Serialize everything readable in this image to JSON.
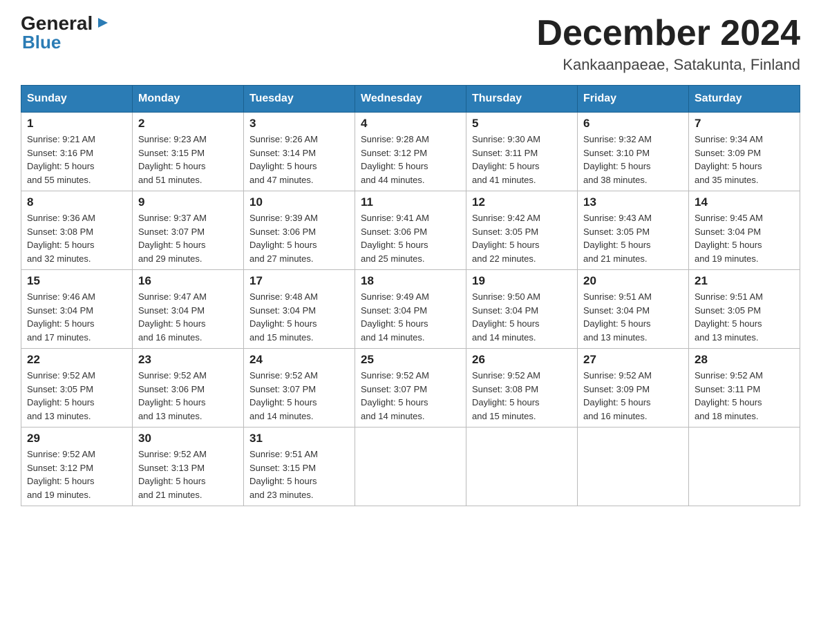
{
  "header": {
    "logo_general": "General",
    "logo_blue": "Blue",
    "month_title": "December 2024",
    "location": "Kankaanpaeae, Satakunta, Finland"
  },
  "days_of_week": [
    "Sunday",
    "Monday",
    "Tuesday",
    "Wednesday",
    "Thursday",
    "Friday",
    "Saturday"
  ],
  "weeks": [
    [
      {
        "day": "1",
        "sunrise": "9:21 AM",
        "sunset": "3:16 PM",
        "daylight": "5 hours and 55 minutes."
      },
      {
        "day": "2",
        "sunrise": "9:23 AM",
        "sunset": "3:15 PM",
        "daylight": "5 hours and 51 minutes."
      },
      {
        "day": "3",
        "sunrise": "9:26 AM",
        "sunset": "3:14 PM",
        "daylight": "5 hours and 47 minutes."
      },
      {
        "day": "4",
        "sunrise": "9:28 AM",
        "sunset": "3:12 PM",
        "daylight": "5 hours and 44 minutes."
      },
      {
        "day": "5",
        "sunrise": "9:30 AM",
        "sunset": "3:11 PM",
        "daylight": "5 hours and 41 minutes."
      },
      {
        "day": "6",
        "sunrise": "9:32 AM",
        "sunset": "3:10 PM",
        "daylight": "5 hours and 38 minutes."
      },
      {
        "day": "7",
        "sunrise": "9:34 AM",
        "sunset": "3:09 PM",
        "daylight": "5 hours and 35 minutes."
      }
    ],
    [
      {
        "day": "8",
        "sunrise": "9:36 AM",
        "sunset": "3:08 PM",
        "daylight": "5 hours and 32 minutes."
      },
      {
        "day": "9",
        "sunrise": "9:37 AM",
        "sunset": "3:07 PM",
        "daylight": "5 hours and 29 minutes."
      },
      {
        "day": "10",
        "sunrise": "9:39 AM",
        "sunset": "3:06 PM",
        "daylight": "5 hours and 27 minutes."
      },
      {
        "day": "11",
        "sunrise": "9:41 AM",
        "sunset": "3:06 PM",
        "daylight": "5 hours and 25 minutes."
      },
      {
        "day": "12",
        "sunrise": "9:42 AM",
        "sunset": "3:05 PM",
        "daylight": "5 hours and 22 minutes."
      },
      {
        "day": "13",
        "sunrise": "9:43 AM",
        "sunset": "3:05 PM",
        "daylight": "5 hours and 21 minutes."
      },
      {
        "day": "14",
        "sunrise": "9:45 AM",
        "sunset": "3:04 PM",
        "daylight": "5 hours and 19 minutes."
      }
    ],
    [
      {
        "day": "15",
        "sunrise": "9:46 AM",
        "sunset": "3:04 PM",
        "daylight": "5 hours and 17 minutes."
      },
      {
        "day": "16",
        "sunrise": "9:47 AM",
        "sunset": "3:04 PM",
        "daylight": "5 hours and 16 minutes."
      },
      {
        "day": "17",
        "sunrise": "9:48 AM",
        "sunset": "3:04 PM",
        "daylight": "5 hours and 15 minutes."
      },
      {
        "day": "18",
        "sunrise": "9:49 AM",
        "sunset": "3:04 PM",
        "daylight": "5 hours and 14 minutes."
      },
      {
        "day": "19",
        "sunrise": "9:50 AM",
        "sunset": "3:04 PM",
        "daylight": "5 hours and 14 minutes."
      },
      {
        "day": "20",
        "sunrise": "9:51 AM",
        "sunset": "3:04 PM",
        "daylight": "5 hours and 13 minutes."
      },
      {
        "day": "21",
        "sunrise": "9:51 AM",
        "sunset": "3:05 PM",
        "daylight": "5 hours and 13 minutes."
      }
    ],
    [
      {
        "day": "22",
        "sunrise": "9:52 AM",
        "sunset": "3:05 PM",
        "daylight": "5 hours and 13 minutes."
      },
      {
        "day": "23",
        "sunrise": "9:52 AM",
        "sunset": "3:06 PM",
        "daylight": "5 hours and 13 minutes."
      },
      {
        "day": "24",
        "sunrise": "9:52 AM",
        "sunset": "3:07 PM",
        "daylight": "5 hours and 14 minutes."
      },
      {
        "day": "25",
        "sunrise": "9:52 AM",
        "sunset": "3:07 PM",
        "daylight": "5 hours and 14 minutes."
      },
      {
        "day": "26",
        "sunrise": "9:52 AM",
        "sunset": "3:08 PM",
        "daylight": "5 hours and 15 minutes."
      },
      {
        "day": "27",
        "sunrise": "9:52 AM",
        "sunset": "3:09 PM",
        "daylight": "5 hours and 16 minutes."
      },
      {
        "day": "28",
        "sunrise": "9:52 AM",
        "sunset": "3:11 PM",
        "daylight": "5 hours and 18 minutes."
      }
    ],
    [
      {
        "day": "29",
        "sunrise": "9:52 AM",
        "sunset": "3:12 PM",
        "daylight": "5 hours and 19 minutes."
      },
      {
        "day": "30",
        "sunrise": "9:52 AM",
        "sunset": "3:13 PM",
        "daylight": "5 hours and 21 minutes."
      },
      {
        "day": "31",
        "sunrise": "9:51 AM",
        "sunset": "3:15 PM",
        "daylight": "5 hours and 23 minutes."
      },
      null,
      null,
      null,
      null
    ]
  ],
  "labels": {
    "sunrise": "Sunrise:",
    "sunset": "Sunset:",
    "daylight": "Daylight:"
  }
}
